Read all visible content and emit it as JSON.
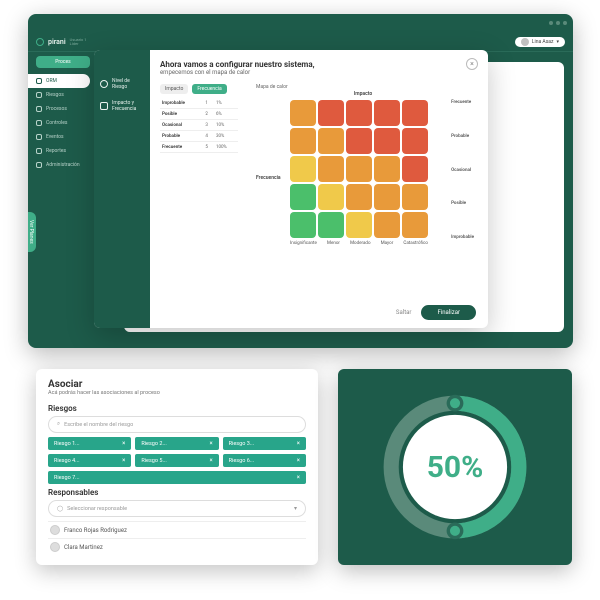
{
  "colors": {
    "accent": "#3fae88",
    "brand_dark": "#1d5b4a",
    "heat_green": "#4bbf6b",
    "heat_yellow": "#f0c94a",
    "heat_orange": "#e89a3a",
    "heat_red": "#df5a3e"
  },
  "app": {
    "logo": "pirani",
    "logo_sub1": "Usuario 1",
    "logo_sub2": "Lider",
    "user": "Lina Asaz"
  },
  "sidebar": {
    "proceso_btn": "Proces",
    "items": [
      "ORM",
      "Riesgos",
      "Procesos",
      "Controles",
      "Eventos",
      "Reportes",
      "Administración"
    ],
    "vert_pill": "Ver Planes"
  },
  "modal": {
    "title": "Ahora vamos a configurar nuestro sistema,",
    "subtitle": "empecemos con el mapa de calor",
    "side_items": [
      "Nivel de Riesgo",
      "Impacto y Frecuencia"
    ],
    "tab_impacto": "Impacto",
    "tab_frecuencia": "Frecuencia",
    "freq_table": [
      {
        "label": "Improbable",
        "n": "1",
        "pct": "1%"
      },
      {
        "label": "Posible",
        "n": "2",
        "pct": "6%"
      },
      {
        "label": "Ocasional",
        "n": "3",
        "pct": "10%"
      },
      {
        "label": "Probable",
        "n": "4",
        "pct": "30%"
      },
      {
        "label": "Frecuente",
        "n": "5",
        "pct": "100%"
      }
    ],
    "heatmap_title": "Mapa de calor",
    "x_title": "Impacto",
    "y_title": "Frecuencia",
    "x_labels": [
      "Insignificante",
      "Menor",
      "Moderado",
      "Mayor",
      "Catastrófico"
    ],
    "y_labels": [
      "Frecuente",
      "Probable",
      "Ocasional",
      "Posible",
      "Improbable"
    ],
    "btn_skip": "Saltar",
    "btn_finish": "Finalizar"
  },
  "chart_data": {
    "type": "heatmap",
    "title": "Mapa de calor",
    "xlabel": "Impacto",
    "ylabel": "Frecuencia",
    "x_categories": [
      "Insignificante",
      "Menor",
      "Moderado",
      "Mayor",
      "Catastrófico"
    ],
    "y_categories": [
      "Frecuente",
      "Probable",
      "Ocasional",
      "Posible",
      "Improbable"
    ],
    "values": [
      [
        2,
        3,
        3,
        3,
        3
      ],
      [
        2,
        2,
        3,
        3,
        3
      ],
      [
        1,
        2,
        2,
        2,
        3
      ],
      [
        0,
        1,
        2,
        2,
        2
      ],
      [
        0,
        0,
        1,
        2,
        2
      ]
    ],
    "levels": [
      "heat_green",
      "heat_yellow",
      "heat_orange",
      "heat_red"
    ]
  },
  "asociar": {
    "title": "Asociar",
    "subtitle": "Acá podrás hacer las asociaciones al proceso",
    "riesgos_label": "Riesgos",
    "riesgos_placeholder": "Escribe el nombre del riesgo",
    "chips": [
      [
        "Riesgo 1...",
        "Riesgo 2...",
        "Riesgo 3..."
      ],
      [
        "Riesgo 4...",
        "Riesgo 5...",
        "Riesgo 6..."
      ],
      [
        "Riesgo 7..."
      ]
    ],
    "responsables_label": "Responsables",
    "responsables_placeholder": "Seleccionar responsable",
    "responsables": [
      "Franco Rojas Rodriguez",
      "Clara Martinez"
    ]
  },
  "gauge": {
    "percent": 50,
    "label": "50%"
  }
}
